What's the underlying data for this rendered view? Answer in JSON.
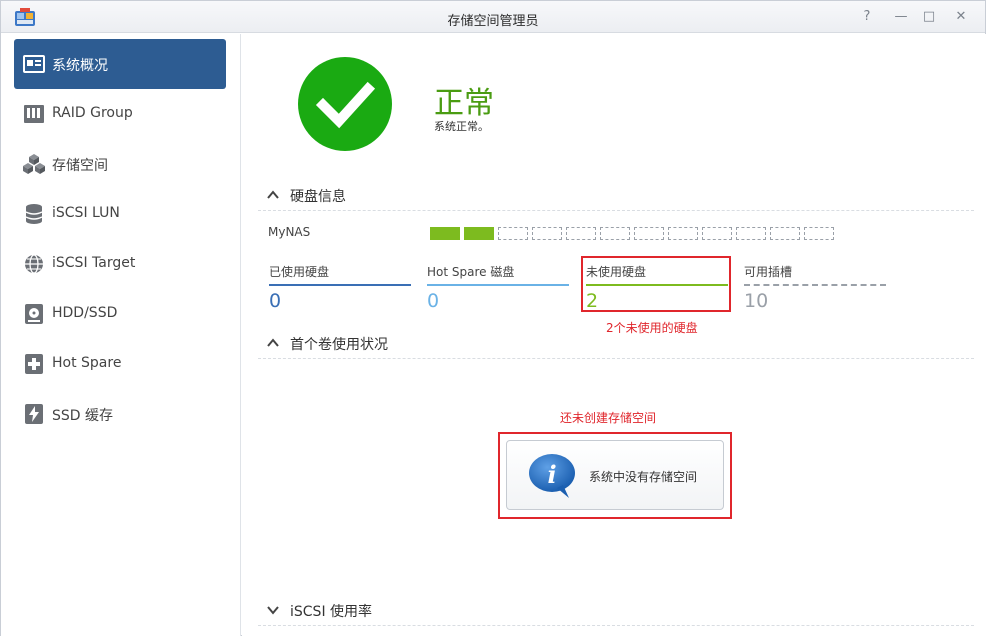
{
  "window": {
    "title": "存储空间管理员"
  },
  "title_controls": {
    "help": "?",
    "minimize": "—",
    "maximize": "□",
    "close": "✕"
  },
  "sidebar": {
    "items": [
      {
        "label": "系统概况",
        "icon": "overview-icon",
        "active": true
      },
      {
        "label": "RAID Group",
        "icon": "raid-group-icon",
        "active": false
      },
      {
        "label": "存储空间",
        "icon": "storage-cubes-icon",
        "active": false
      },
      {
        "label": "iSCSI LUN",
        "icon": "database-icon",
        "active": false
      },
      {
        "label": "iSCSI Target",
        "icon": "globe-icon",
        "active": false
      },
      {
        "label": "HDD/SSD",
        "icon": "disk-icon",
        "active": false
      },
      {
        "label": "Hot Spare",
        "icon": "plus-box-icon",
        "active": false
      },
      {
        "label": "SSD 缓存",
        "icon": "ssd-cache-icon",
        "active": false
      }
    ]
  },
  "status": {
    "title": "正常",
    "description": "系统正常。",
    "color": "#1aaa12"
  },
  "disk_info": {
    "header": "硬盘信息",
    "nas_name": "MyNAS",
    "slots_total": 12,
    "slots_used": 2,
    "stats": [
      {
        "label": "已使用硬盘",
        "value": "0",
        "color": "#3a6fb5"
      },
      {
        "label": "Hot Spare 磁盘",
        "value": "0",
        "color": "#6ab2e6"
      },
      {
        "label": "未使用硬盘",
        "value": "2",
        "color": "#7dbb1f"
      },
      {
        "label": "可用插槽",
        "value": "10",
        "color": "#9aa0a8"
      }
    ],
    "annotation": "2个未使用的硬盘"
  },
  "first_volume": {
    "header": "首个卷使用状况",
    "annotation": "还未创建存储空间",
    "message": "系统中没有存储空间"
  },
  "iscsi": {
    "header": "iSCSI 使用率"
  },
  "colors": {
    "accent": "#2d5c92",
    "annotation": "#e0262c",
    "ok": "#4a9c12"
  }
}
